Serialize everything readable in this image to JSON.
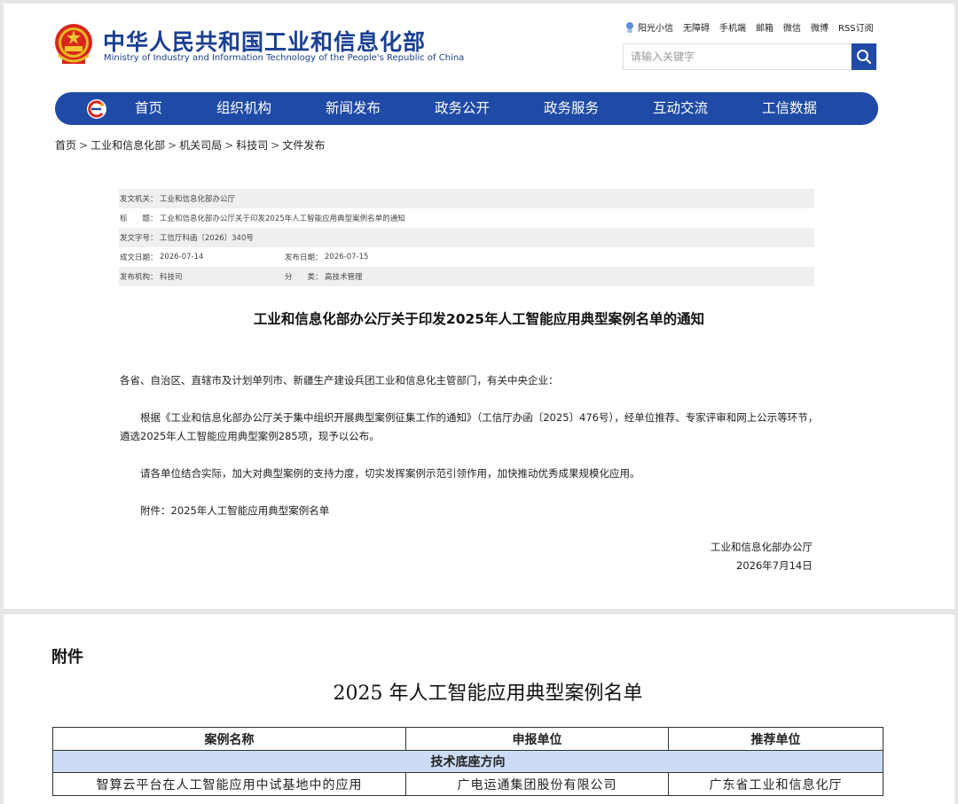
{
  "header": {
    "site_title": "中华人民共和国工业和信息化部",
    "site_subtitle": "Ministry of Industry and Information Technology of the People's Republic of China",
    "top_links": [
      "阳光小信",
      "无障碍",
      "手机端",
      "邮箱",
      "微信",
      "微博",
      "RSS订阅"
    ],
    "search_placeholder": "请输入关键字",
    "brand_color": "#1f4aa6"
  },
  "nav": {
    "items": [
      "首页",
      "组织机构",
      "新闻发布",
      "政务公开",
      "政务服务",
      "互动交流",
      "工信数据"
    ]
  },
  "breadcrumb": {
    "items": [
      "首页",
      "工业和信息化部",
      "机关司局",
      "科技司",
      "文件发布"
    ],
    "separator": ">"
  },
  "meta": {
    "issuer_label": "发文机关：",
    "issuer": "工业和信息化部办公厅",
    "title_label": "标　　题：",
    "title": "工业和信息化部办公厅关于印发2025年人工智能应用典型案例名单的通知",
    "doc_no_label": "发文字号：",
    "doc_no": "工信厅科函〔2026〕340号",
    "created_label": "成文日期：",
    "created": "2026-07-14",
    "published_label": "发布日期：",
    "published": "2026-07-15",
    "org_label": "发布机构：",
    "org": "科技司",
    "category_label": "分　　类：",
    "category": "高技术管理"
  },
  "document": {
    "title": "工业和信息化部办公厅关于印发2025年人工智能应用典型案例名单的通知",
    "salutation": "各省、自治区、直辖市及计划单列市、新疆生产建设兵团工业和信息化主管部门，有关中央企业：",
    "para1_line1": "根据《工业和信息化部办公厅关于集中组织开展典型案例征集工作的通知》（工信厅办函〔2025〕476号），经单位推荐、专家评审和网上公示等环节，",
    "para1_line2": "遴选2025年人工智能应用典型案例285项，现予以公布。",
    "para2": "请各单位结合实际，加大对典型案例的支持力度，切实发挥案例示范引领作用，加快推动优秀成果规模化应用。",
    "attachment": "附件：2025年人工智能应用典型案例名单",
    "signature": "工业和信息化部办公厅",
    "date": "2026年7月14日"
  },
  "attachment_page": {
    "label": "附件",
    "title": "2025 年人工智能应用典型案例名单",
    "columns": [
      "案例名称",
      "申报单位",
      "推荐单位"
    ],
    "section": "技术底座方向",
    "section_color": "#cddcf5",
    "rows": [
      [
        "智算云平台在人工智能应用中试基地中的应用",
        "广电运通集团股份有限公司",
        "广东省工业和信息化厅"
      ]
    ]
  }
}
